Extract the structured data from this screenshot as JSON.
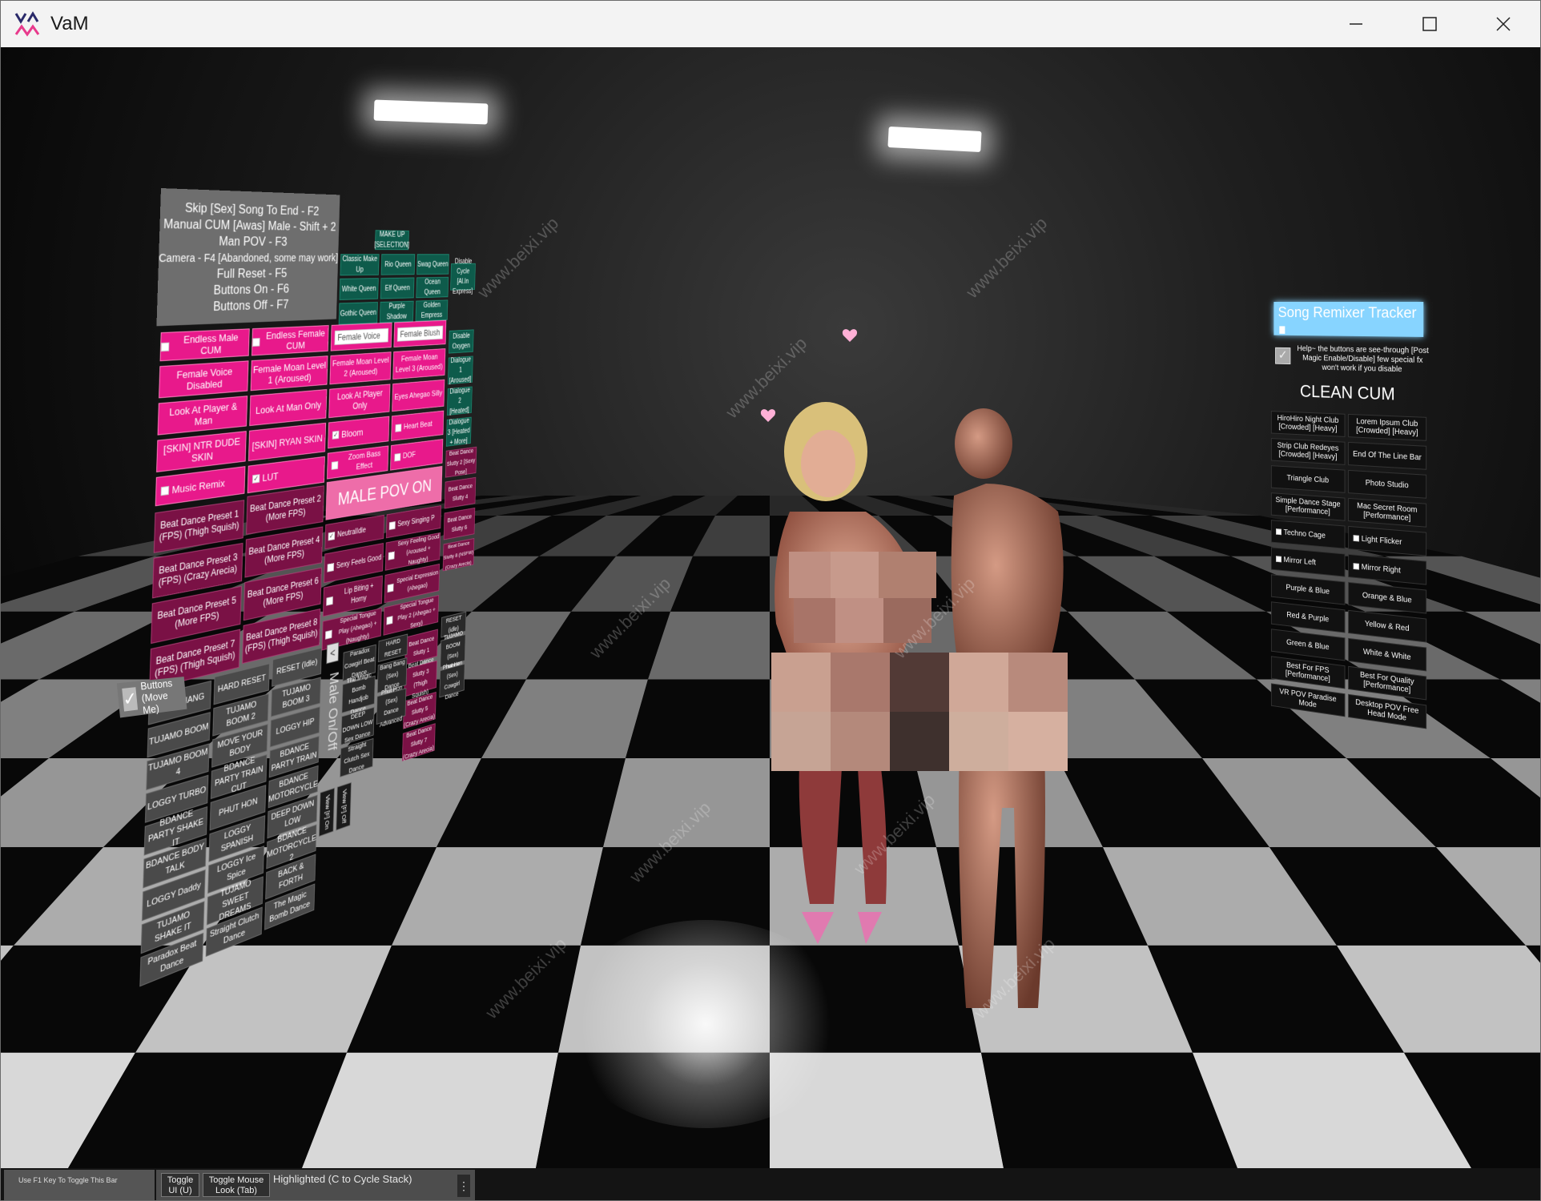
{
  "window": {
    "title": "VaM"
  },
  "panel_left": {
    "hotkeys": [
      "Skip [Sex] Song To End - F2",
      "Manual CUM [Awas] Male - Shift + 2",
      "Man POV - F3",
      "Camera - F4 [Abandoned, some may work]",
      "Full Reset - F5",
      "Buttons On - F6",
      "Buttons Off - F7"
    ],
    "makeup_title": "MAKE UP [SELECTION]",
    "makeup": [
      "Classic Make Up",
      "Rio Queen",
      "Swag Queen",
      "White Queen",
      "Elf Queen",
      "Ocean Queen",
      "Gothic Queen",
      "Purple Shadow",
      "Golden Empress"
    ],
    "teal_labels": [
      "Disable Cycle [Al.In Express]",
      "Disable Oxygen",
      "Dialogue 1 [Aroused]",
      "Dialogue 2 [Heated]",
      "Dialogue 3 [Heated + More]"
    ],
    "endless_male": "Endless Male CUM",
    "endless_female": "Endless Female CUM",
    "female_voice": "Female Voice",
    "female_blush": "Female Blush",
    "female_voice_disabled": "Female Voice Disabled",
    "moan_1": "Female Moan Level 1 (Aroused)",
    "moan_2": "Female Moan Level 2 (Aroused)",
    "moan_3": "Female Moan Level 3 (Aroused)",
    "look_player_man": "Look At Player & Man",
    "look_man_only": "Look At Man Only",
    "look_player_only": "Look At Player Only",
    "eyes_ahegao": "Eyes Ahegao Silly",
    "skin_ntr": "[SKIN] NTR DUDE SKIN",
    "skin_ryan": "[SKIN] RYAN SKIN",
    "bloom": "Bloom",
    "heart_beat": "Heart Beat",
    "lut": "LUT",
    "zoom_bass": "Zoom Bass Effect",
    "dof": "DOF",
    "music_remix": "Music Remix",
    "male_pov": "MALE POV ON",
    "beat_presets": [
      "Beat Dance Preset 1 (FPS) (Thigh Squish)",
      "Beat Dance Preset 2 (More FPS)",
      "Beat Dance Preset 3 (FPS) (Crazy Arecia)",
      "Beat Dance Preset 4 (More FPS)",
      "Beat Dance Preset 5 (More FPS)",
      "Beat Dance Preset 6 (More FPS)",
      "Beat Dance Preset 7 (FPS) (Thigh Squish)",
      "Beat Dance Preset 8 (FPS) (Thigh Squish)"
    ],
    "dance_sluts": [
      "Beat Dance Slutty 1",
      "Beat Dance Slutty 2 [Sexy Pose]",
      "Beat Dance Slutty 3 (Thigh Squish)",
      "Beat Dance Slutty 4",
      "Beat Dance Slutty 5 (Crazy Arecia)",
      "Beat Dance Slutty 6",
      "Beat Dance Slutty 7 (Crazy Arecia)",
      "Beat Dance Slutty 8 (NSFW) (Crazy Arecia)"
    ],
    "expressions": [
      "NeutralIdle",
      "Sexy Singing P",
      "Sexy Feels Good",
      "Sexy Feeling Good (Aroused + Naughty)",
      "Lip Biting + Horny",
      "Special Expression (Ahegao)",
      "Special Tongue Play (Ahegao) + (Naughty)",
      "Special Tongue Play 2 (Ahegao + Sexy)"
    ],
    "gray_col_1": [
      "NEW THANG",
      "TUJAMO BOOM",
      "TUJAMO BOOM 4",
      "LOGGY TURBO",
      "BDANCE PARTY SHAKE IT",
      "BDANCE BODY TALK",
      "LOGGY Daddy",
      "TUJAMO SHAKE IT",
      "Paradox Beat Dance"
    ],
    "gray_col_2": [
      "HARD RESET",
      "TUJAMO BOOM 2",
      "MOVE YOUR BODY",
      "BDANCE PARTY TRAIN CUT",
      "PHUT HON",
      "LOGGY SPANISH",
      "LOGGY Ice Spice",
      "TUJAMO SWEET DREAMS",
      "Straight Clutch Dance"
    ],
    "gray_col_3": [
      "RESET (Idle)",
      "TUJAMO BOOM 3",
      "LOGGY HIP",
      "BDANCE PARTY TRAIN",
      "BDANCE MOTORCYCLE",
      "DEEP DOWN LOW",
      "BDANCE MOTORCYCLE 2",
      "BACK & FORTH",
      "The Magic Bomb Dance"
    ],
    "gray_col_4": [
      "Paradox Cowgirl Beat Dance",
      "The Magic Bomb Handjob Dance",
      "DEEP DOWN LOW Sex Dance",
      "Straight Clutch Sex Dance"
    ],
    "gray_col_5": [
      "HARD RESET",
      "Bang Bang (Sex) Dance",
      "Phut Hon (Sex) Dance Advanced"
    ],
    "gray_col_6": [
      "RESET (idle)",
      "TUJAMO BOOM (Sex) Dance",
      "Phut Hon (Sex) Cowgirl Dance"
    ],
    "male_onoff": "Male On/Off",
    "arrow": "<",
    "view_f_on": "View [F] On",
    "view_f_off": "View [F] Off",
    "buttons_move": "Buttons (Move Me)"
  },
  "panel_right": {
    "title": "Song Remixer Tracker",
    "help": "Help~ the buttons are see-through [Post Magic Enable/Disable] few special fx won't work if you disable",
    "clean_cum": "CLEAN CUM",
    "items": [
      "HiroHiro Night Club [Crowded] [Heavy]",
      "Lorem Ipsum Club [Crowded] [Heavy]",
      "Strip Club Redeyes [Crowded] [Heavy]",
      "End Of The Line Bar",
      "Triangle Club",
      "Photo Studio",
      "Simple Dance Stage [Performance]",
      "Mac Secret Room [Performance]",
      "Techno Cage",
      "Light Flicker",
      "Mirror Left",
      "Mirror Right",
      "Purple & Blue",
      "Orange & Blue",
      "Red & Purple",
      "Yellow & Red",
      "Green & Blue",
      "White & White",
      "Best For FPS [Performance]",
      "Best For Quality [Performance]",
      "VR POV Paradise Mode",
      "Desktop POV Free Head Mode"
    ]
  },
  "watermark": "www.beixi.vip",
  "statusbar": {
    "f1_hint": "Use F1 Key To Toggle This Bar",
    "toggle_ui": "Toggle UI (U)",
    "toggle_mouse": "Toggle Mouse Look (Tab)",
    "highlighted": "Highlighted (C to Cycle Stack)",
    "menu": "⋮"
  },
  "colors": {
    "pink": "#e8198b",
    "accent_blue": "#87d4ff",
    "teal": "#0e5b4b"
  }
}
